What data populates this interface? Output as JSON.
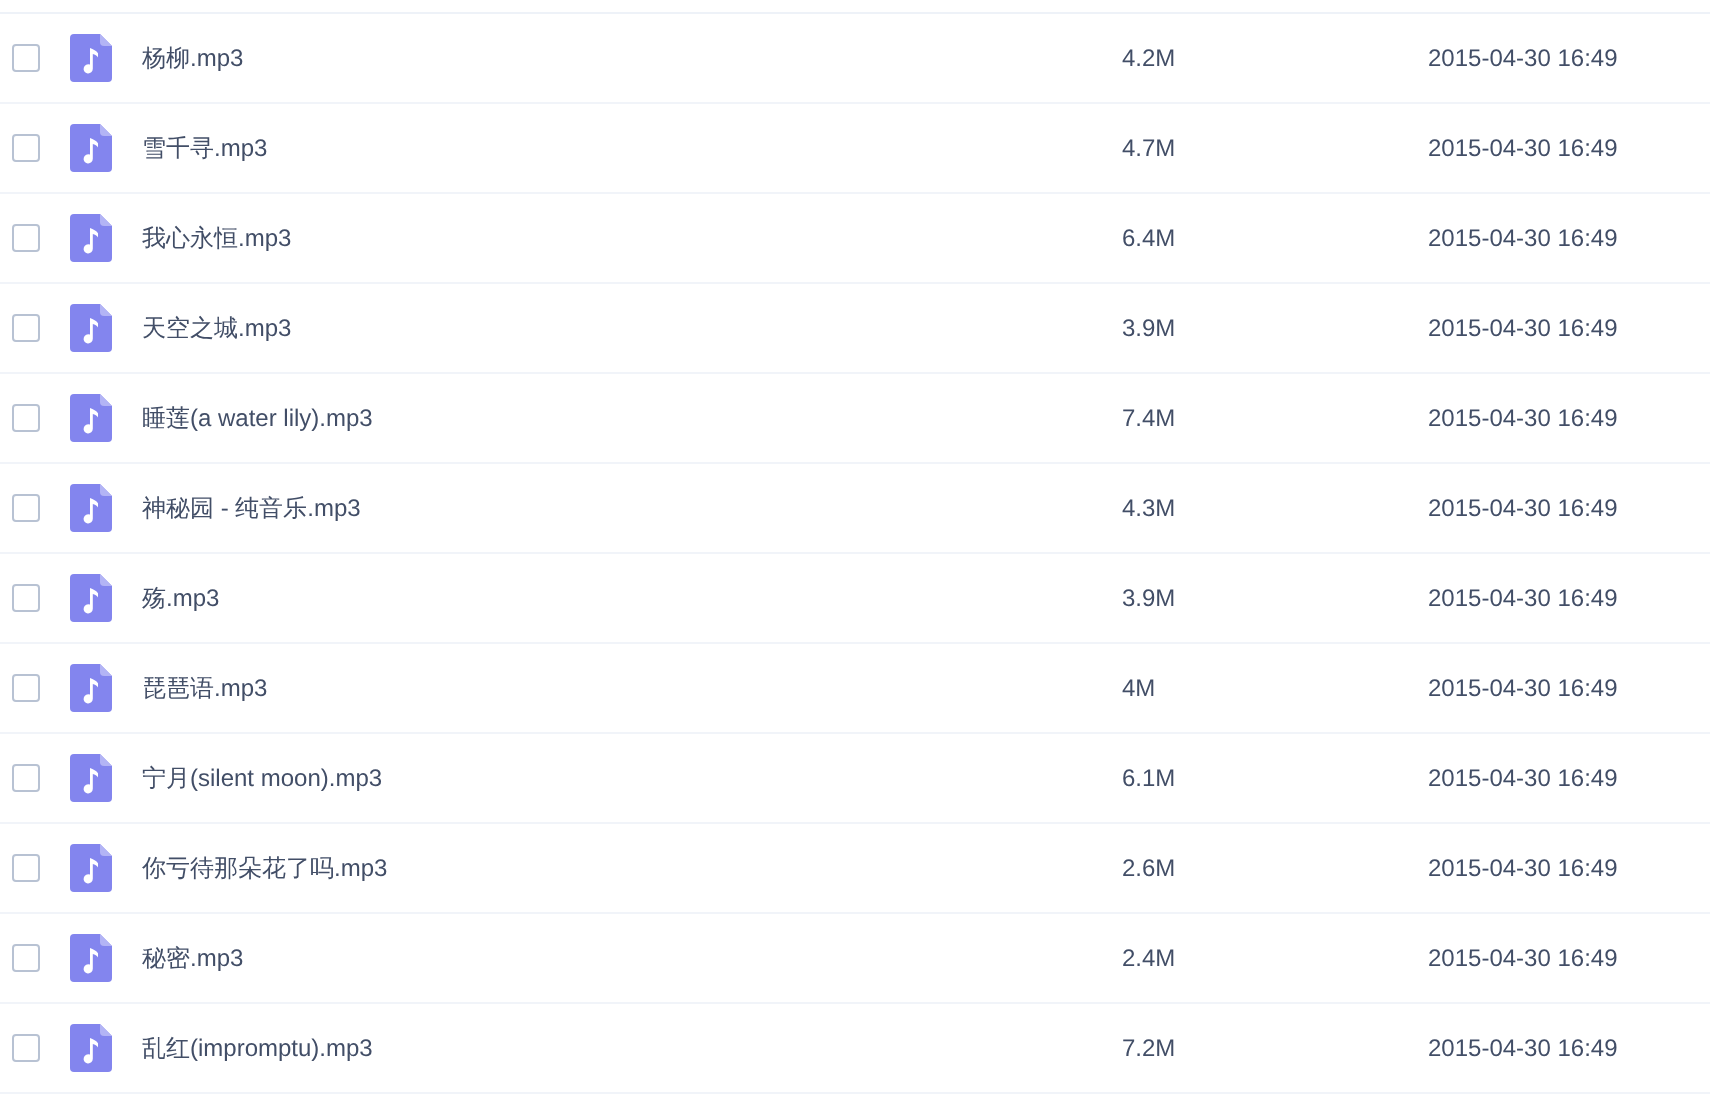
{
  "files": [
    {
      "name": "杨柳.mp3",
      "size": "4.2M",
      "modified": "2015-04-30 16:49",
      "checked": false
    },
    {
      "name": "雪千寻.mp3",
      "size": "4.7M",
      "modified": "2015-04-30 16:49",
      "checked": false
    },
    {
      "name": "我心永恒.mp3",
      "size": "6.4M",
      "modified": "2015-04-30 16:49",
      "checked": false
    },
    {
      "name": "天空之城.mp3",
      "size": "3.9M",
      "modified": "2015-04-30 16:49",
      "checked": false
    },
    {
      "name": "睡莲(a water lily).mp3",
      "size": "7.4M",
      "modified": "2015-04-30 16:49",
      "checked": false
    },
    {
      "name": "神秘园 - 纯音乐.mp3",
      "size": "4.3M",
      "modified": "2015-04-30 16:49",
      "checked": false
    },
    {
      "name": "殇.mp3",
      "size": "3.9M",
      "modified": "2015-04-30 16:49",
      "checked": false
    },
    {
      "name": "琵琶语.mp3",
      "size": "4M",
      "modified": "2015-04-30 16:49",
      "checked": false
    },
    {
      "name": "宁月(silent moon).mp3",
      "size": "6.1M",
      "modified": "2015-04-30 16:49",
      "checked": false
    },
    {
      "name": "你亏待那朵花了吗.mp3",
      "size": "2.6M",
      "modified": "2015-04-30 16:49",
      "checked": false
    },
    {
      "name": "秘密.mp3",
      "size": "2.4M",
      "modified": "2015-04-30 16:49",
      "checked": false
    },
    {
      "name": "乱红(impromptu).mp3",
      "size": "7.2M",
      "modified": "2015-04-30 16:49",
      "checked": false
    }
  ]
}
